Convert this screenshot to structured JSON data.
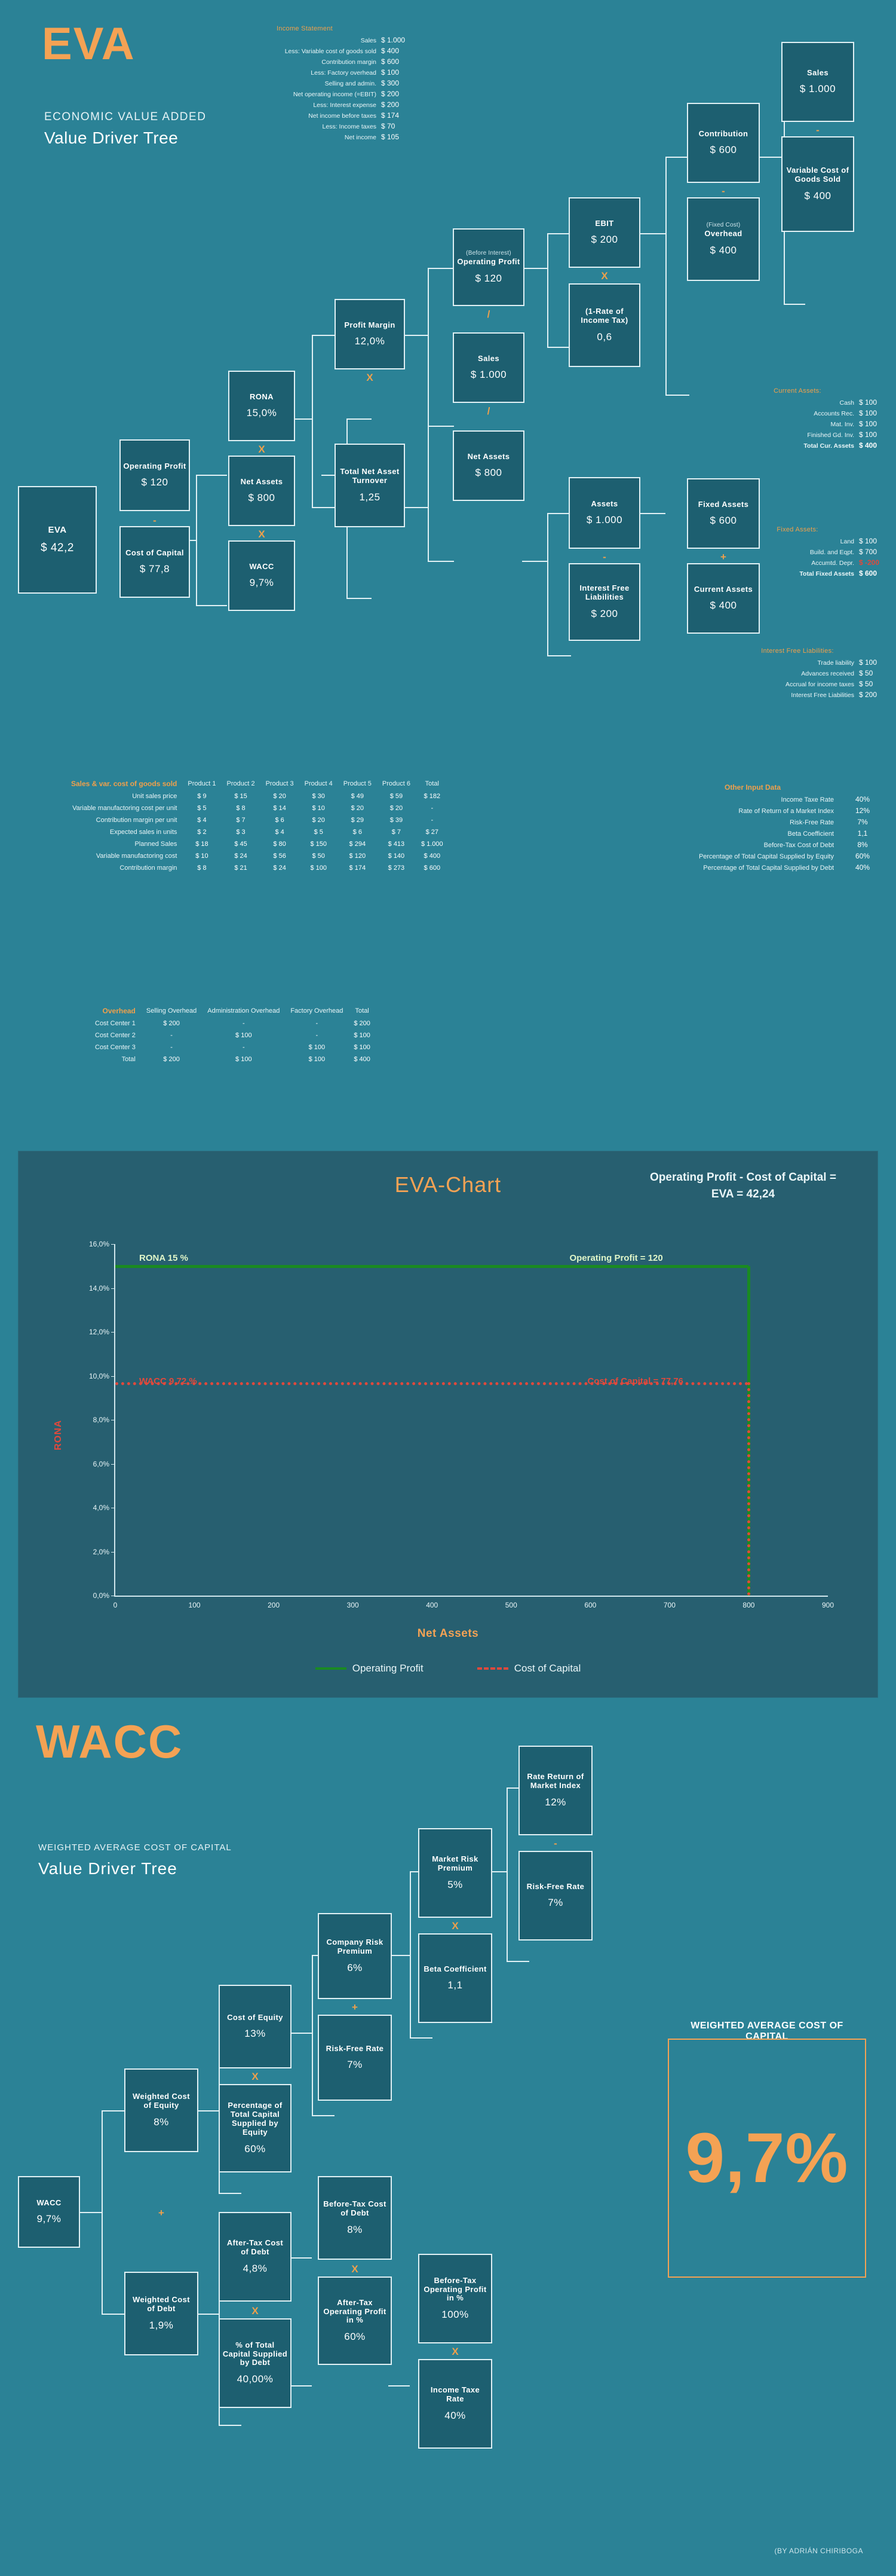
{
  "colors": {
    "bg": "#2b8296",
    "panel": "#275f70",
    "node": "#1d5f70",
    "accent": "#f4a254",
    "green": "#1a8a22",
    "red": "#e0493c",
    "stroke": "#dff0f4"
  },
  "eva_header": {
    "logo": "EVA",
    "sub1": "ECONOMIC VALUE ADDED",
    "sub2": "Value Driver Tree"
  },
  "income_statement": {
    "title": "Income Statement",
    "rows": [
      {
        "label": "Sales",
        "amount": "$ 1.000"
      },
      {
        "label": "Less: Variable cost of goods sold",
        "amount": "$ 400"
      },
      {
        "label": "Contribution margin",
        "amount": "$ 600"
      },
      {
        "label": "Less: Factory overhead",
        "amount": "$ 100"
      },
      {
        "label": "Selling and admin.",
        "amount": "$ 300"
      },
      {
        "label": "Net operating income (=EBIT)",
        "amount": "$ 200"
      },
      {
        "label": "Less: Interest expense",
        "amount": "$ 200"
      },
      {
        "label": "Net income before taxes",
        "amount": "$ 174"
      },
      {
        "label": "Less: Income taxes",
        "amount": "$ 70"
      },
      {
        "label": "Net income",
        "amount": "$ 105"
      }
    ]
  },
  "current_assets": {
    "title": "Current Assets:",
    "rows": [
      {
        "label": "Cash",
        "amount": "$ 100",
        "bold": false,
        "negative": false
      },
      {
        "label": "Accounts Rec.",
        "amount": "$ 100",
        "bold": false,
        "negative": false
      },
      {
        "label": "Mat. Inv.",
        "amount": "$ 100",
        "bold": false,
        "negative": false
      },
      {
        "label": "Finished Gd. Inv.",
        "amount": "$ 100",
        "bold": false,
        "negative": false
      },
      {
        "label": "Total Cur. Assets",
        "amount": "$ 400",
        "bold": true,
        "negative": false
      }
    ]
  },
  "fixed_assets": {
    "title": "Fixed Assets:",
    "rows": [
      {
        "label": "Land",
        "amount": "$ 100",
        "bold": false,
        "negative": false
      },
      {
        "label": "Build. and Eqpt.",
        "amount": "$ 700",
        "bold": false,
        "negative": false
      },
      {
        "label": "Accumtd. Depr.",
        "amount": "$ -200",
        "bold": false,
        "negative": true
      },
      {
        "label": "Total Fixed Assets",
        "amount": "$ 600",
        "bold": true,
        "negative": false
      }
    ]
  },
  "interest_free_liabilities": {
    "title": "Interest Free Liabilities:",
    "rows": [
      {
        "label": "Trade liability",
        "amount": "$ 100",
        "bold": false,
        "negative": false
      },
      {
        "label": "Advances received",
        "amount": "$ 50",
        "bold": false,
        "negative": false
      },
      {
        "label": "Accrual for income taxes",
        "amount": "$ 50",
        "bold": false,
        "negative": false
      },
      {
        "label": "Interest Free Liabilities",
        "amount": "$ 200",
        "bold": false,
        "negative": false
      }
    ]
  },
  "eva_tree": {
    "eva": {
      "title": "EVA",
      "value": "$ 42,2",
      "caption": ""
    },
    "operating_profit_1": {
      "title": "Operating Profit",
      "value": "$ 120",
      "caption": ""
    },
    "cost_of_capital": {
      "title": "Cost of Capital",
      "value": "$ 77,8",
      "caption": ""
    },
    "rona": {
      "title": "RONA",
      "value": "15,0%",
      "caption": ""
    },
    "net_assets_1": {
      "title": "Net Assets",
      "value": "$ 800",
      "caption": ""
    },
    "wacc": {
      "title": "WACC",
      "value": "9,7%",
      "caption": ""
    },
    "profit_margin": {
      "title": "Profit Margin",
      "value": "12,0%",
      "caption": ""
    },
    "total_net_asset_turnover": {
      "title": "Total Net Asset Turnover",
      "value": "1,25",
      "caption": ""
    },
    "operating_profit_2": {
      "title": "Operating Profit",
      "value": "$ 120",
      "caption": "(Before Interest)"
    },
    "sales_1": {
      "title": "Sales",
      "value": "$ 1.000",
      "caption": ""
    },
    "net_assets_2": {
      "title": "Net Assets",
      "value": "$ 800",
      "caption": ""
    },
    "ebit": {
      "title": "EBIT",
      "value": "$ 200",
      "caption": ""
    },
    "one_minus_tax": {
      "title": "(1-Rate of Income Tax)",
      "value": "0,6",
      "caption": ""
    },
    "assets": {
      "title": "Assets",
      "value": "$ 1.000",
      "caption": ""
    },
    "interest_free_liab": {
      "title": "Interest Free Liabilities",
      "value": "$ 200",
      "caption": ""
    },
    "contribution": {
      "title": "Contribution",
      "value": "$ 600",
      "caption": ""
    },
    "overhead": {
      "title": "Overhead",
      "value": "$ 400",
      "caption": "(Fixed Cost)"
    },
    "fixed_assets_box": {
      "title": "Fixed Assets",
      "value": "$ 600",
      "caption": ""
    },
    "current_assets_box": {
      "title": "Current Assets",
      "value": "$ 400",
      "caption": ""
    },
    "sales_2": {
      "title": "Sales",
      "value": "$ 1.000",
      "caption": ""
    },
    "variable_cogs": {
      "title": "Variable Cost of Goods Sold",
      "value": "$ 400",
      "caption": ""
    },
    "ops": {
      "minus": "-",
      "times": "X",
      "divide": "/",
      "plus": "+"
    }
  },
  "product_table": {
    "corner": "Sales & var. cost of goods sold",
    "columns": [
      "Product 1",
      "Product 2",
      "Product 3",
      "Product 4",
      "Product 5",
      "Product 6",
      "Total"
    ],
    "rows": [
      {
        "label": "Unit sales price",
        "values": [
          "$ 9",
          "$ 15",
          "$ 20",
          "$ 30",
          "$ 49",
          "$ 59",
          "$ 182"
        ]
      },
      {
        "label": "Variable manufactoring cost per unit",
        "values": [
          "$ 5",
          "$ 8",
          "$ 14",
          "$ 10",
          "$ 20",
          "$ 20",
          "-"
        ]
      },
      {
        "label": "Contribution margin per unit",
        "values": [
          "$ 4",
          "$ 7",
          "$ 6",
          "$ 20",
          "$ 29",
          "$ 39",
          "-"
        ]
      },
      {
        "label": "Expected sales in units",
        "values": [
          "$ 2",
          "$ 3",
          "$ 4",
          "$ 5",
          "$ 6",
          "$ 7",
          "$ 27"
        ]
      },
      {
        "label": "Planned Sales",
        "values": [
          "$ 18",
          "$ 45",
          "$ 80",
          "$ 150",
          "$ 294",
          "$ 413",
          "$ 1.000"
        ]
      },
      {
        "label": "Variable manufactoring cost",
        "values": [
          "$ 10",
          "$ 24",
          "$ 56",
          "$ 50",
          "$ 120",
          "$ 140",
          "$ 400"
        ]
      },
      {
        "label": "Contribution margin",
        "values": [
          "$ 8",
          "$ 21",
          "$ 24",
          "$ 100",
          "$ 174",
          "$ 273",
          "$ 600"
        ]
      }
    ]
  },
  "other_input_data": {
    "title": "Other Input Data",
    "rows": [
      {
        "key": "Income Taxe Rate",
        "value": "40%"
      },
      {
        "key": "Rate of Return of a Market Index",
        "value": "12%"
      },
      {
        "key": "Risk-Free Rate",
        "value": "7%"
      },
      {
        "key": "Beta Coefficient",
        "value": "1,1"
      },
      {
        "key": "Before-Tax Cost of Debt",
        "value": "8%"
      },
      {
        "key": "Percentage of Total Capital Supplied by Equity",
        "value": "60%"
      },
      {
        "key": "Percentage of Total Capital Supplied by Debt",
        "value": "40%"
      }
    ]
  },
  "overhead_table": {
    "corner": "Overhead",
    "columns": [
      "Selling Overhead",
      "Administration Overhead",
      "Factory Overhead",
      "Total"
    ],
    "rows": [
      {
        "label": "Cost Center 1",
        "values": [
          "$ 200",
          "-",
          "-",
          "$ 200"
        ]
      },
      {
        "label": "Cost Center 2",
        "values": [
          "-",
          "$ 100",
          "-",
          "$ 100"
        ]
      },
      {
        "label": "Cost Center 3",
        "values": [
          "-",
          "-",
          "$ 100",
          "$ 100"
        ]
      },
      {
        "label": "Total",
        "values": [
          "$ 200",
          "$ 100",
          "$ 100",
          "$ 400"
        ]
      }
    ]
  },
  "chart_data": {
    "type": "line",
    "title": "EVA-Chart",
    "note": "Operating Profit - Cost of Capital = EVA = 42,24",
    "xlabel": "Net Assets",
    "ylabel": "RONA",
    "xlim": [
      0,
      900
    ],
    "ylim": [
      0,
      16
    ],
    "xticks": [
      0,
      100,
      200,
      300,
      400,
      500,
      600,
      700,
      800,
      900
    ],
    "yticks": [
      "0,0%",
      "2,0%",
      "4,0%",
      "6,0%",
      "8,0%",
      "10,0%",
      "12,0%",
      "14,0%",
      "16,0%"
    ],
    "grid": false,
    "legend_position": "bottom",
    "series": [
      {
        "name": "Operating Profit",
        "style": "solid",
        "color": "#1a8a22",
        "y_value": 15.0,
        "x_end": 800,
        "start_label": "RONA 15 %",
        "end_label": "Operating Profit = 120"
      },
      {
        "name": "Cost of Capital",
        "style": "dotted",
        "color": "#e0493c",
        "y_value": 9.72,
        "x_end": 800,
        "start_label": "WACC 9,72 %",
        "end_label": "Cost of Capital = 77,76"
      }
    ],
    "legend": [
      "Operating Profit",
      "Cost of Capital"
    ]
  },
  "wacc_header": {
    "logo": "WACC",
    "sub1": "WEIGHTED AVERAGE COST OF CAPITAL",
    "sub2": "Value  Driver  Tree"
  },
  "wacc_tree": {
    "wacc": {
      "title": "WACC",
      "value": "9,7%"
    },
    "weighted_equity": {
      "title": "Weighted Cost of Equity",
      "value": "8%"
    },
    "weighted_debt": {
      "title": "Weighted Cost of Debt",
      "value": "1,9%"
    },
    "cost_of_equity": {
      "title": "Cost of Equity",
      "value": "13%"
    },
    "pct_equity": {
      "title": "Percentage of Total Capital Supplied by Equity",
      "value": "60%"
    },
    "after_tax_debt": {
      "title": "After-Tax Cost of Debt",
      "value": "4,8%"
    },
    "pct_debt": {
      "title": "% of Total Capital Supplied by Debt",
      "value": "40,00%"
    },
    "company_risk_prem": {
      "title": "Company Risk Premium",
      "value": "6%"
    },
    "risk_free_rate_1": {
      "title": "Risk-Free Rate",
      "value": "7%"
    },
    "before_tax_debt": {
      "title": "Before-Tax Cost of Debt",
      "value": "8%"
    },
    "after_tax_op_pct": {
      "title": "After-Tax Operating Profit in %",
      "value": "60%"
    },
    "market_risk_prem": {
      "title": "Market Risk Premium",
      "value": "5%"
    },
    "beta_coeff": {
      "title": "Beta Coefficient",
      "value": "1,1"
    },
    "before_tax_op_pct": {
      "title": "Before-Tax Operating Profit in %",
      "value": "100%"
    },
    "income_taxe_rate": {
      "title": "Income Taxe Rate",
      "value": "40%"
    },
    "rate_return_index": {
      "title": "Rate Return of Market Index",
      "value": "12%"
    },
    "risk_free_rate_2": {
      "title": "Risk-Free Rate",
      "value": "7%"
    },
    "ops": {
      "plus": "+",
      "times": "X",
      "minus": "-"
    }
  },
  "wacc_result": {
    "title": "WEIGHTED AVERAGE COST OF CAPITAL",
    "value": "9,7%"
  },
  "credit": "(BY ADRIÁN CHIRIBOGA"
}
